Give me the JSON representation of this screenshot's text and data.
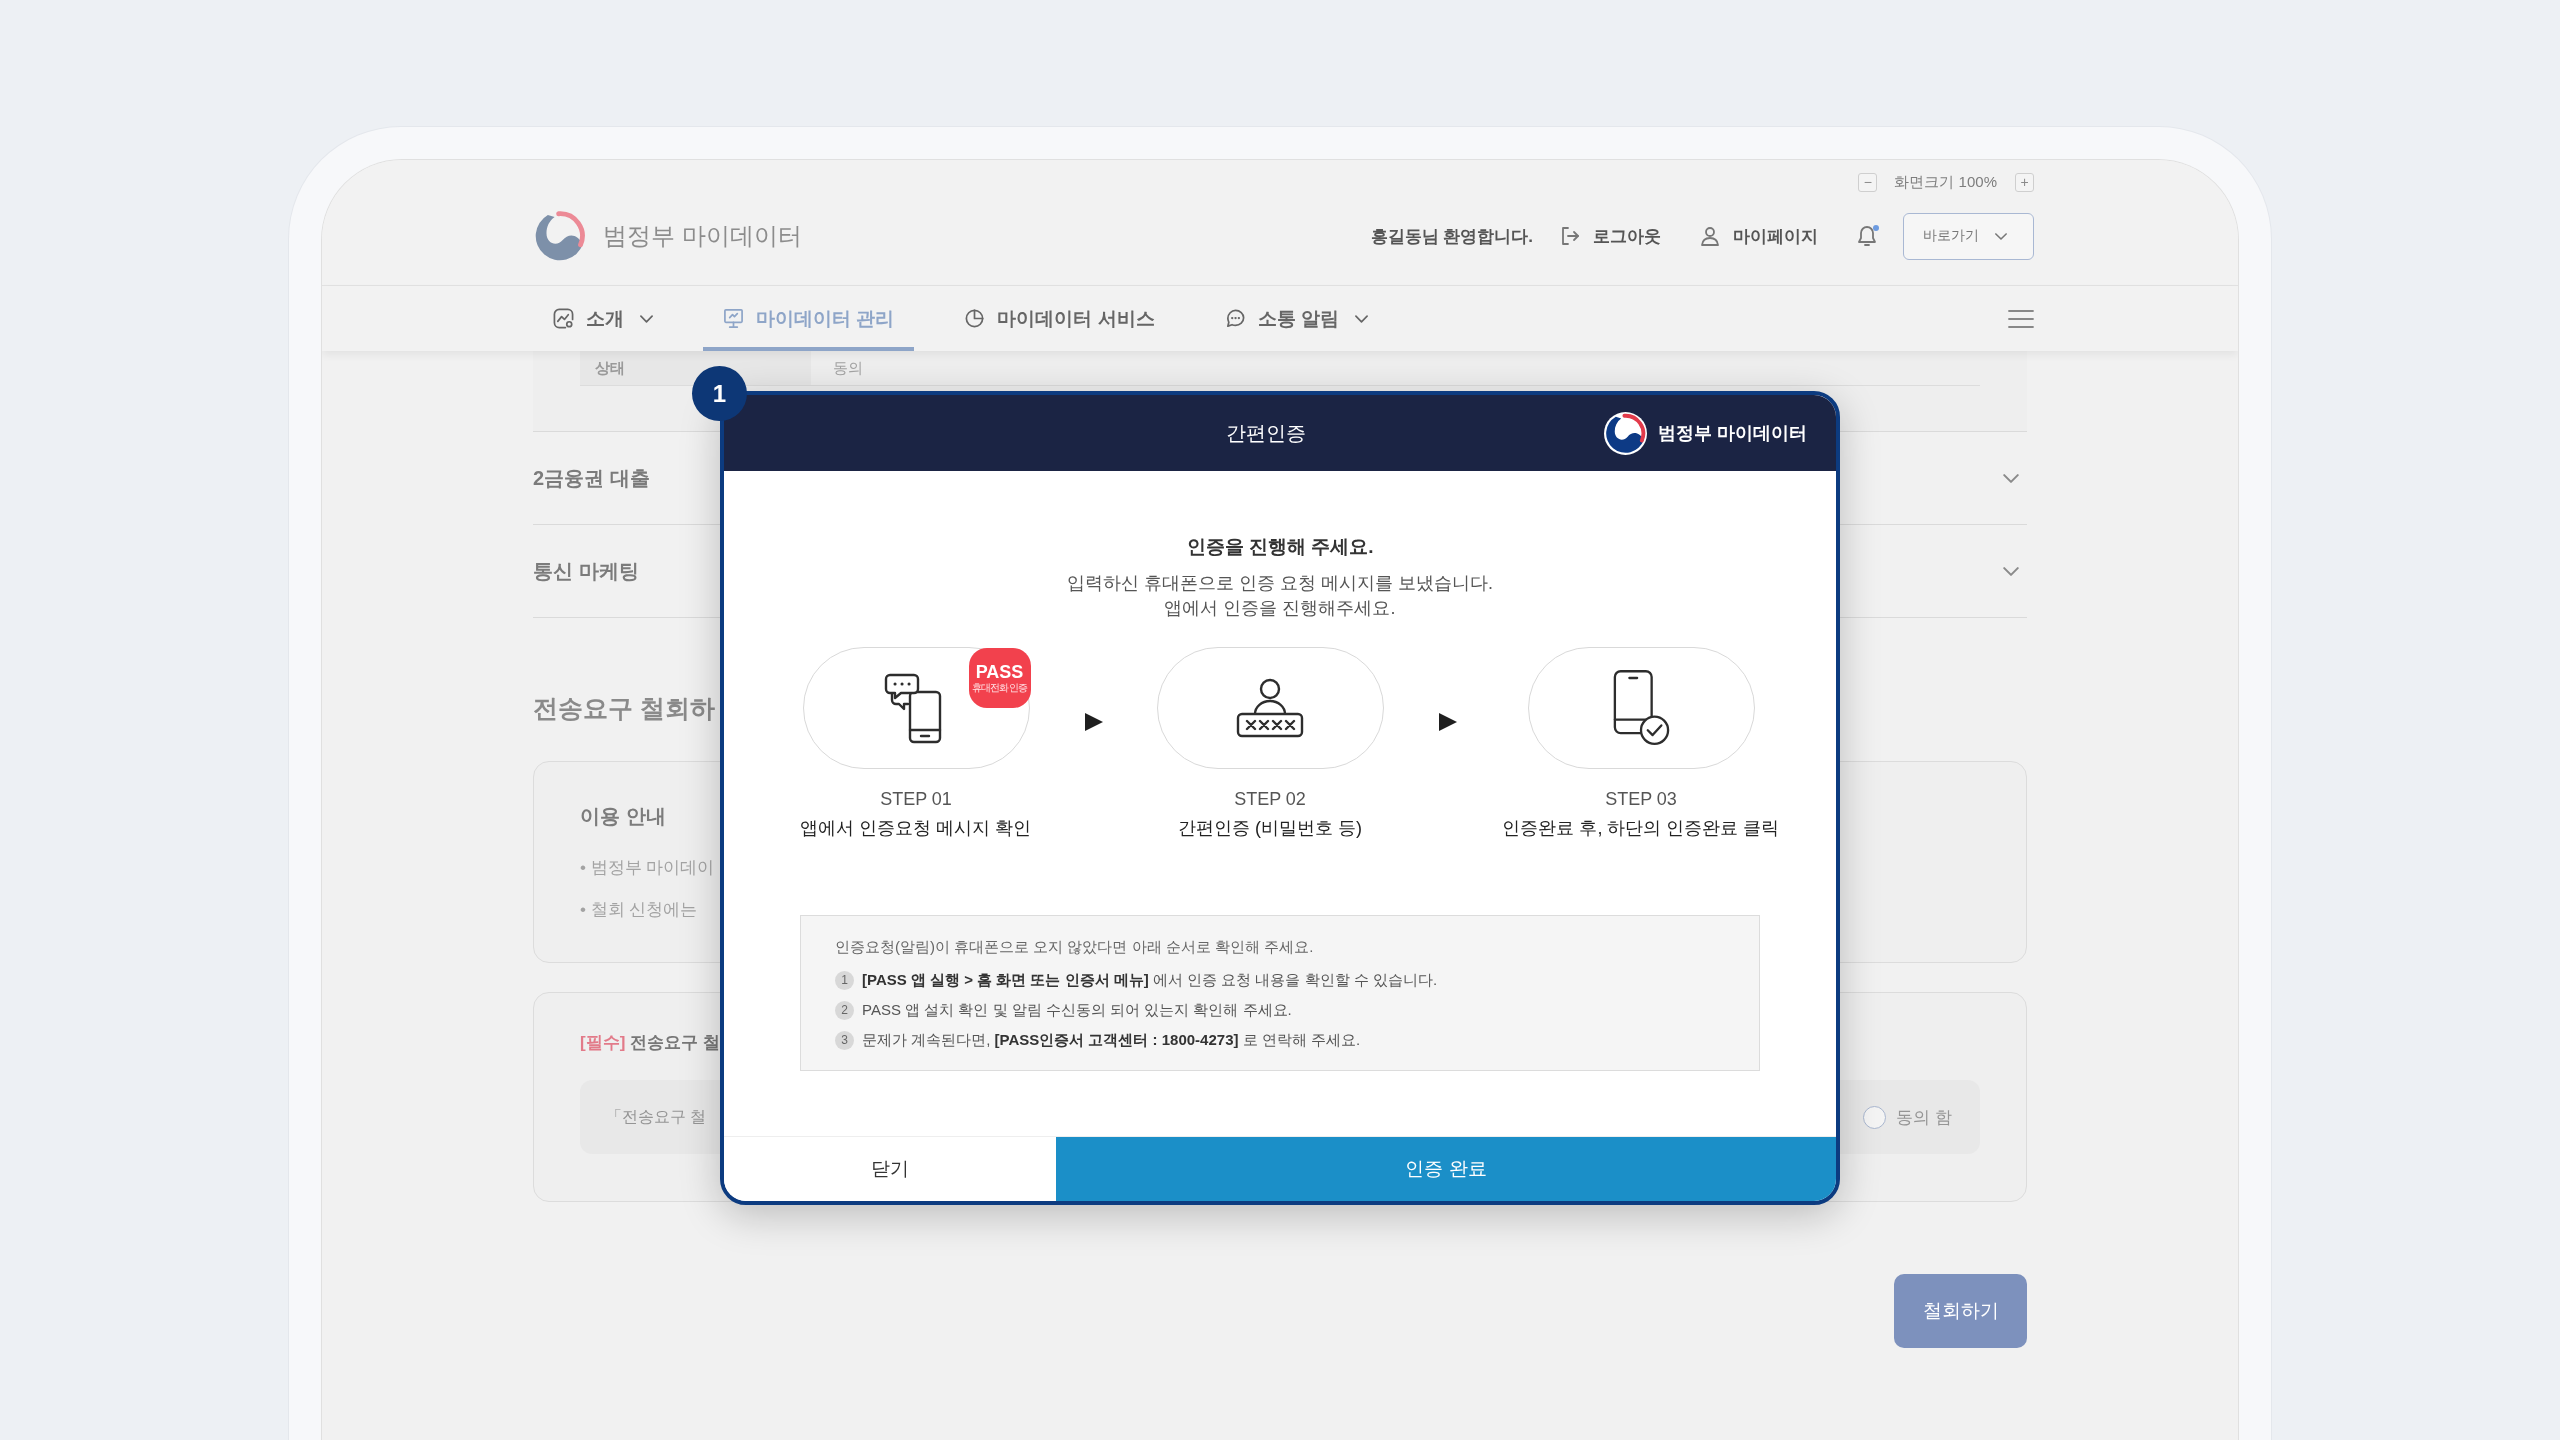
{
  "callout": {
    "number": "1"
  },
  "header": {
    "zoom": {
      "decrease": "−",
      "label": "화면크기 100%",
      "increase": "+"
    },
    "logo_text": "범정부 마이데이터",
    "welcome": "홍길동님 환영합니다.",
    "links": [
      {
        "kind": "logout",
        "label": "로그아웃"
      },
      {
        "kind": "mypage",
        "label": "마이페이지"
      }
    ],
    "notifications": {
      "unread": true
    },
    "quick_menu": {
      "label": "바로가기",
      "expanded": false
    }
  },
  "nav": {
    "items": [
      {
        "label": "소개",
        "dropdown": true,
        "selected": false
      },
      {
        "label": "마이데이터 관리",
        "dropdown": false,
        "selected": true
      },
      {
        "label": "마이데이터 서비스",
        "dropdown": false,
        "selected": false
      },
      {
        "label": "소통 알림",
        "dropdown": true,
        "selected": false
      }
    ]
  },
  "page": {
    "detail_row": {
      "label": "상태",
      "value": "동의"
    },
    "accordion": [
      {
        "label": "2금융권 대출",
        "expanded": false
      },
      {
        "label": "통신 마케팅",
        "expanded": false
      }
    ],
    "section_title": "전송요구 철회하",
    "guide": {
      "title": "이용 안내",
      "items": [
        "• 범정부 마이데이",
        "• 철회 신청에는"
      ]
    },
    "agreement": {
      "required_tag": "[필수]",
      "title": "전송요구 철",
      "statement": "「전송요구 철",
      "consent": {
        "label": "동의 함",
        "checked": false
      }
    },
    "submit": {
      "label": "철회하기",
      "disabled": true
    }
  },
  "modal": {
    "title": "간편인증",
    "brand": "범정부 마이데이터",
    "heading": "인증을 진행해 주세요.",
    "message": [
      "입력하신 휴대폰으로 인증 요청 메시지를 보냈습니다.",
      "앱에서 인증을 진행해주세요."
    ],
    "steps": [
      {
        "step": "STEP 01",
        "text": "앱에서 인증요청 메시지 확인",
        "badge": {
          "title": "PASS",
          "subtitle": "휴대전화 인증"
        }
      },
      {
        "step": "STEP 02",
        "text": "간편인증 (비밀번호 등)"
      },
      {
        "step": "STEP 03",
        "text": "인증완료 후, 하단의 인증완료 클릭"
      }
    ],
    "notice": {
      "intro": "인증요청(알림)이 휴대폰으로 오지 않았다면 아래 순서로 확인해 주세요.",
      "items": [
        {
          "number": "1",
          "text": "**[PASS 앱 실행 > 홈 화면 또는 인증서 메뉴]** 에서 인증 요청 내용을 확인할 수 있습니다."
        },
        {
          "number": "2",
          "text": "PASS 앱 설치 확인 및 알림 수신동의 되어 있는지 확인해 주세요."
        },
        {
          "number": "3",
          "text": "문제가 계속된다면, **[PASS인증서 고객센터 : 1800-4273]** 로 연락해 주세요."
        }
      ]
    },
    "buttons": [
      {
        "kind": "close",
        "label": "닫기"
      },
      {
        "kind": "confirm",
        "label": "인증 완료"
      }
    ]
  }
}
